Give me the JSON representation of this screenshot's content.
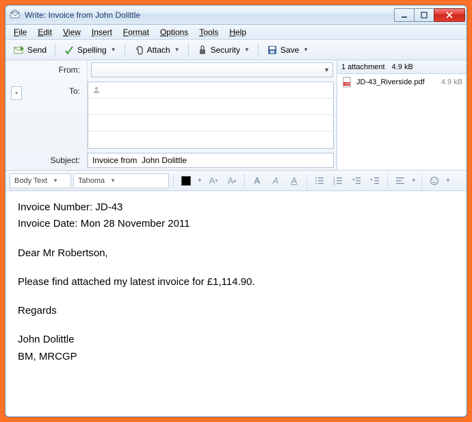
{
  "window": {
    "title": "Write: Invoice from John Dolittle"
  },
  "menubar": {
    "items": [
      "File",
      "Edit",
      "View",
      "Insert",
      "Format",
      "Options",
      "Tools",
      "Help"
    ]
  },
  "toolbar": {
    "send": "Send",
    "spelling": "Spelling",
    "attach": "Attach",
    "security": "Security",
    "save": "Save"
  },
  "fields": {
    "from_label": "From:",
    "to_label": "To:",
    "subject_label": "Subject:",
    "subject_value": "Invoice from  John Dolittle"
  },
  "attachments": {
    "count_label": "1 attachment",
    "total_size": "4.9 kB",
    "items": [
      {
        "name": "JD-43_Riverside.pdf",
        "size": "4.9 kB"
      }
    ]
  },
  "format": {
    "style": "Body Text",
    "font": "Tahoma"
  },
  "body": {
    "line1": "Invoice Number: JD-43",
    "line2": "Invoice Date: Mon 28 November 2011",
    "line3": "Dear Mr Robertson,",
    "line4": "Please find attached my latest invoice for £1,114.90.",
    "line5": "Regards",
    "line6": "John Dolittle",
    "line7": "BM, MRCGP"
  }
}
